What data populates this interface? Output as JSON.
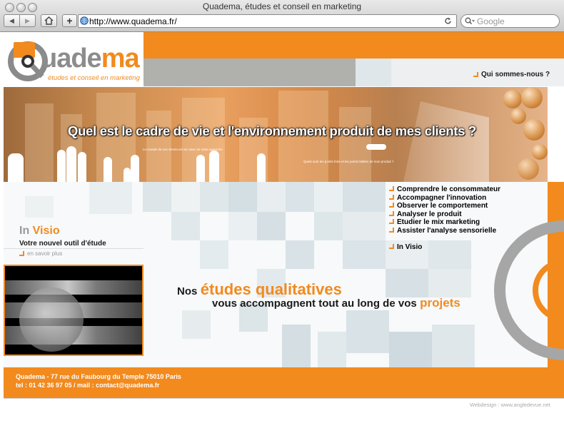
{
  "browser": {
    "window_title": "Quadema, études et conseil en marketing",
    "url": "http://www.quadema.fr/",
    "search_placeholder": "Google",
    "back_icon": "left-triangle",
    "forward_icon": "right-triangle",
    "home_icon": "house",
    "add_icon": "plus",
    "reload_icon": "circular-arrow"
  },
  "site": {
    "logo": {
      "name": "Quadema",
      "tagline": "études et conseil en marketing"
    },
    "nav_link": "Qui sommes-nous ?",
    "banner_headline": "Quel est le cadre de vie et l'environnement produit de mes clients ?",
    "banner_caption_1": "Le monde de nos clients est au cœur de notre approche",
    "banner_caption_2": "Quels sont les points forts et les points faibles de mon produit ?",
    "menu": [
      "Comprendre le consommateur",
      "Accompagner l'innovation",
      "Observer le comportement",
      "Analyser le produit",
      "Etudier le mix marketing",
      "Assister l'analyse sensorielle"
    ],
    "menu_invisio": "In Visio",
    "invisio": {
      "title_in": "In",
      "title_visio": "Visio",
      "subtitle": "Votre nouvel outil d'étude",
      "more_link": "en savoir plus"
    },
    "tagline": {
      "part1": "Nos",
      "part2": "études qualitatives",
      "part3": "vous accompagnent tout au long de vos",
      "part4": "projets"
    },
    "footer": {
      "address": "Quadema - 77 rue du Faubourg du Temple 75010 Paris",
      "contact": "tel : 01 42 36 97 05 /  mail : contact@quadema.fr"
    },
    "credit": "Webdesign : www.angledevue.net"
  },
  "colors": {
    "accent": "#f28a1e",
    "gray": "#b0b0b0"
  }
}
